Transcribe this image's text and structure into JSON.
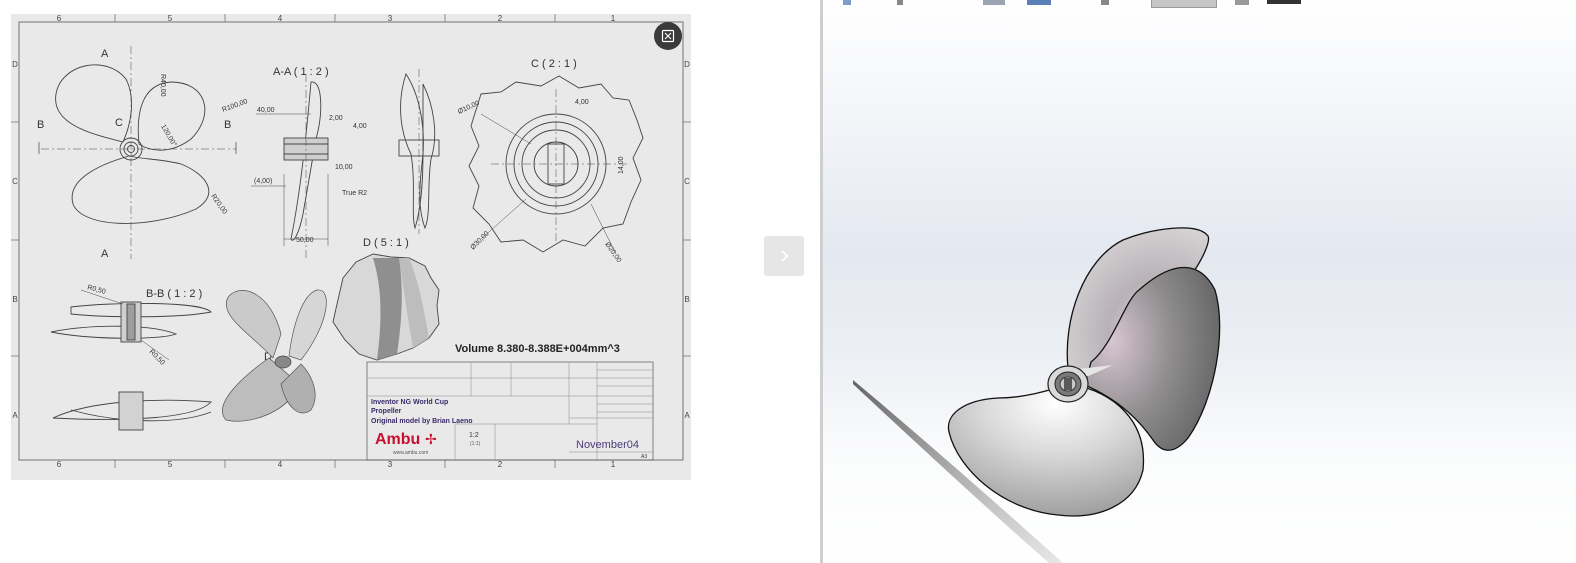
{
  "viewer": {
    "expand_icon": "expand-icon",
    "next_icon": "chevron-right-icon"
  },
  "drawing": {
    "border_numbers_top": [
      "6",
      "5",
      "4",
      "3",
      "2",
      "1"
    ],
    "border_numbers_bottom": [
      "6",
      "5",
      "4",
      "3",
      "2",
      "1"
    ],
    "border_letters_left": [
      "D",
      "C",
      "B",
      "A"
    ],
    "border_letters_right": [
      "D",
      "C",
      "B",
      "A"
    ],
    "section_label_a": "A",
    "section_label_b": "B",
    "section_label_c": "C",
    "section_label_d": "D",
    "view_aa_title": "A-A ( 1 : 2 )",
    "view_c_title": "C ( 2 : 1 )",
    "view_d_title": "D ( 5 : 1 )",
    "view_bb_title": "B-B ( 1 : 2 )",
    "dims": {
      "r40": "R40,00",
      "r100": "R100,00",
      "angle120": "120,00°",
      "r20": "R20,00",
      "d40": "40,00",
      "d2": "2,00",
      "d4": "4,00",
      "d10": "10,00",
      "d4p": "(4,00)",
      "true_r2": "True R2",
      "d50": "50,00",
      "dia10": "Ø10,00",
      "c4": "4,00",
      "c14": "14,00",
      "dia30": "Ø30,00",
      "dia20": "Ø20,00",
      "r05a": "R0,50",
      "r05b": "R0,50"
    },
    "volume": "Volume 8.380-8.388E+004mm^3",
    "title_block": {
      "line1": "Inventor NG World Cup",
      "line2": "Propeller",
      "line3": "Original model by Brian Laeno",
      "logo": "Ambu",
      "website": "www.ambu.com",
      "scale": "1:2",
      "scale_sub": "(1:1)",
      "doc_name": "November04",
      "sheet_size": "A3"
    }
  }
}
